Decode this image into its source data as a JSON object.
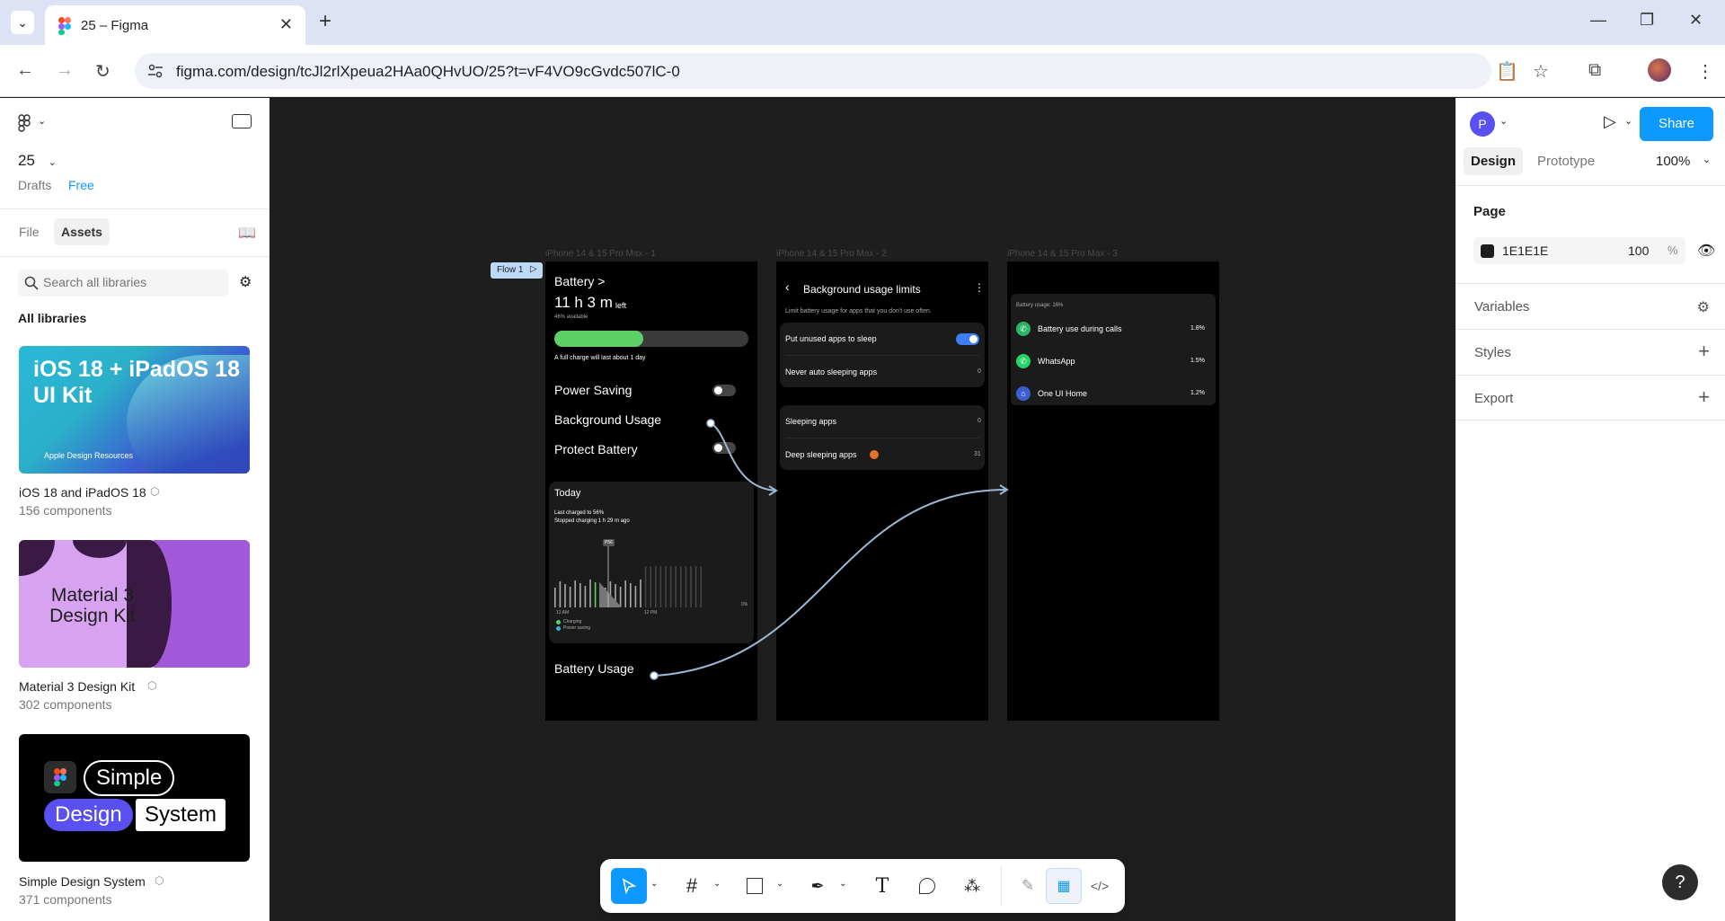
{
  "browser": {
    "tab_title": "25 – Figma",
    "url": "figma.com/design/tcJl2rlXpeua2HAa0QHvUO/25?t=vF4VO9cGvdc507lC-0"
  },
  "left_panel": {
    "file_name": "25",
    "drafts_label": "Drafts",
    "plan_label": "Free",
    "tab_file": "File",
    "tab_assets": "Assets",
    "search_placeholder": "Search all libraries",
    "section_title": "All libraries",
    "libraries": [
      {
        "name": "iOS 18 and iPadOS 18",
        "count": "156 components",
        "thumb_title": "iOS 18 + iPadOS 18 UI Kit",
        "thumb_sub": "Apple Design Resources"
      },
      {
        "name": "Material 3 Design Kit",
        "count": "302 components",
        "thumb_title": "Material 3 Design Kit"
      },
      {
        "name": "Simple Design System",
        "count": "371 components",
        "thumb_words": [
          "Simple",
          "Design",
          "System"
        ]
      }
    ]
  },
  "right_panel": {
    "avatar_letter": "P",
    "share_label": "Share",
    "tab_design": "Design",
    "tab_prototype": "Prototype",
    "zoom": "100%",
    "page_title": "Page",
    "page_color": "1E1E1E",
    "page_opacity": "100",
    "percent": "%",
    "sections": [
      "Variables",
      "Styles",
      "Export"
    ]
  },
  "canvas": {
    "flow_label": "Flow 1",
    "frames": [
      {
        "label": "iPhone 14 & 15 Pro Max - 1"
      },
      {
        "label": "iPhone 14 & 15 Pro Max - 2"
      },
      {
        "label": "iPhone 14 & 15 Pro Max - 3"
      }
    ],
    "frame1": {
      "header": "Battery >",
      "time_left": "11 h 3 m",
      "left_suffix": "left",
      "available": "46% available",
      "charge_note": "A full charge will last about 1 day",
      "level": 0.46,
      "power_saving": "Power Saving",
      "background_usage": "Background Usage",
      "protect_battery": "Protect Battery",
      "today": "Today",
      "last_charged": "Last charged to 56%",
      "stopped_charging": "Stopped charging 1 h 29 m ago",
      "pm_badge": "P56",
      "time_start": "12 AM",
      "time_end": "12 PM",
      "zero": "0%",
      "legend_charging": "Charging",
      "legend_power_saving": "Power saving",
      "battery_usage": "Battery Usage"
    },
    "frame2": {
      "title": "Background usage limits",
      "subtitle": "Limit battery usage for apps that you don't use often.",
      "put_unused": "Put unused apps to sleep",
      "never_auto": "Never auto sleeping apps",
      "never_count": "0",
      "sleeping": "Sleeping apps",
      "sleeping_count": "0",
      "deep_sleeping": "Deep sleeping apps",
      "deep_count": "31"
    },
    "frame3": {
      "usage_header": "Battery usage: 16%",
      "apps": [
        {
          "name": "Battery use during calls",
          "pct": "1.8%"
        },
        {
          "name": "WhatsApp",
          "pct": "1.5%"
        },
        {
          "name": "One UI Home",
          "pct": "1.2%"
        }
      ]
    }
  },
  "colors": {
    "figma_blue": "#0d99ff",
    "canvas_bg": "#1e1e1e",
    "battery_green": "#5fd068",
    "toggle_blue": "#3d7df5",
    "connector": "#9ab7d3"
  },
  "help_label": "?"
}
